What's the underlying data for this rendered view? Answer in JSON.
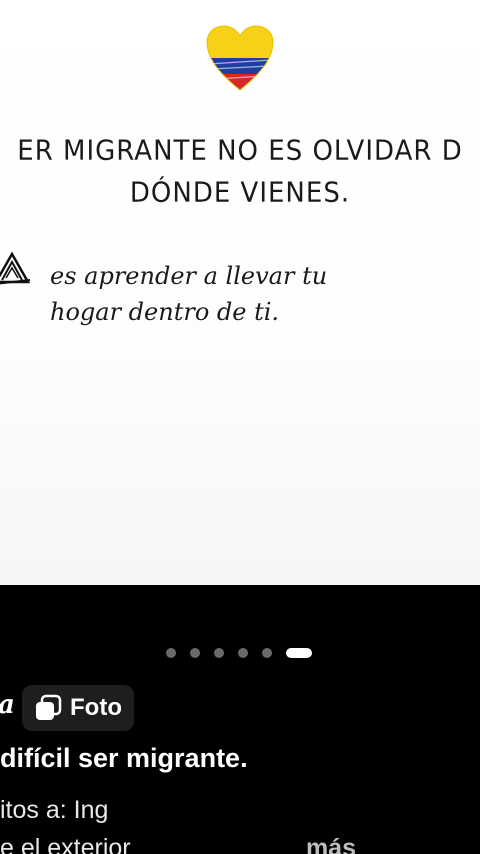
{
  "post_image": {
    "headline_line1": "ER MIGRANTE NO ES OLVIDAR D",
    "headline_line2": "DÓNDE VIENES.",
    "note_line1": "es aprender a llevar tu",
    "note_line2": "hogar dentro de ti.",
    "heart_icon": "venezuela-flag-heart-icon",
    "sketch_icon": "house-sketch-icon",
    "colors": {
      "flag_yellow": "#f7d117",
      "flag_blue": "#1f3f9e",
      "flag_red": "#d62828"
    }
  },
  "carousel": {
    "total": 6,
    "active_index": 5
  },
  "post_meta": {
    "author_fragment": "a",
    "media_type_label": "Foto",
    "media_type_icon": "photos-stack-icon"
  },
  "caption": {
    "title": "difícil ser migrante.",
    "line1": "itos a: Ing",
    "line2": "e el exterior",
    "more_label": "más"
  }
}
